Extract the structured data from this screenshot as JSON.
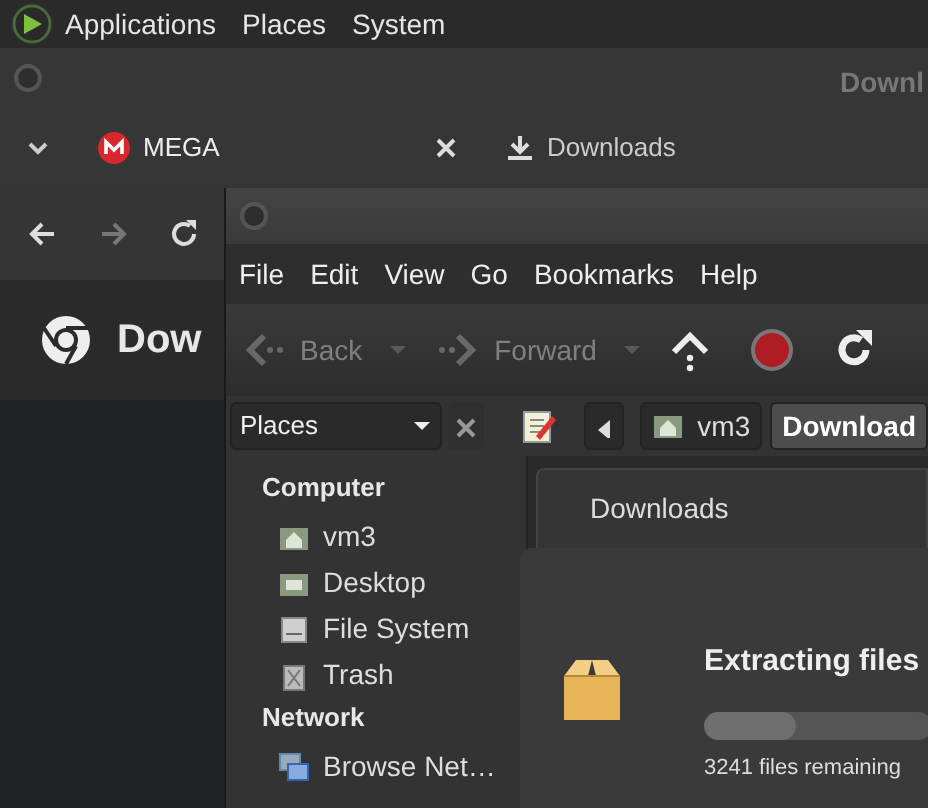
{
  "panel": {
    "menus": [
      "Applications",
      "Places",
      "System"
    ]
  },
  "browser": {
    "title": "Downl",
    "tabs": [
      {
        "label": "MEGA"
      },
      {
        "label": "Downloads"
      }
    ],
    "page_title": "Dow"
  },
  "file_manager": {
    "menus": [
      "File",
      "Edit",
      "View",
      "Go",
      "Bookmarks",
      "Help"
    ],
    "toolbar": [
      {
        "kind": "labeled",
        "label": "Back",
        "disabled": true
      },
      {
        "kind": "labeled",
        "label": "Forward",
        "disabled": true
      },
      {
        "kind": "icon"
      },
      {
        "kind": "icon"
      },
      {
        "kind": "icon"
      }
    ],
    "places_combo": "Places",
    "path": [
      {
        "label": "vm3",
        "selected": false
      },
      {
        "label": "Download",
        "selected": true
      }
    ],
    "sidebar": [
      {
        "heading": "Computer",
        "items": [
          {
            "label": "vm3"
          },
          {
            "label": "Desktop"
          },
          {
            "label": "File System"
          },
          {
            "label": "Trash"
          }
        ]
      },
      {
        "heading": "Network",
        "items": [
          {
            "label": "Browse Net…"
          }
        ]
      }
    ],
    "tab": "Downloads",
    "progress": {
      "title": "Extracting files",
      "level": 0.4,
      "detail": "3241 files remaining"
    }
  }
}
